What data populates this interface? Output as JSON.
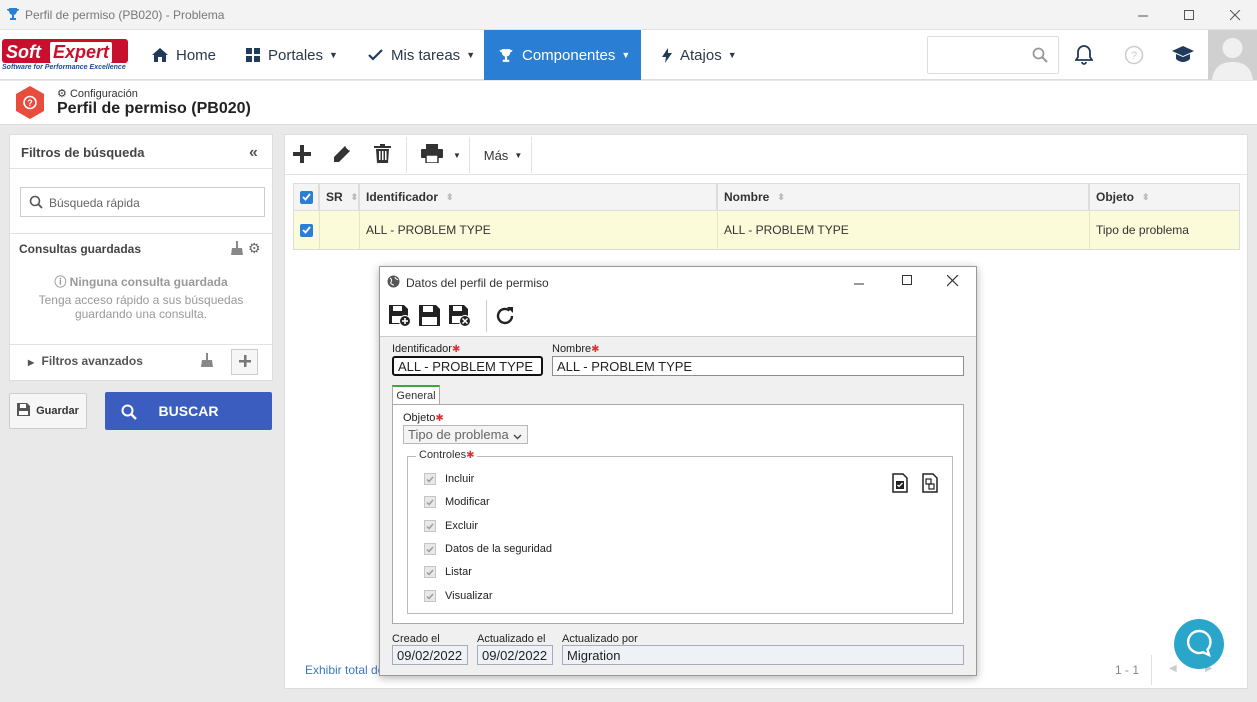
{
  "window": {
    "title": "Perfil de permiso (PB020) - Problema"
  },
  "logo": {
    "brand_soft": "Soft",
    "brand_expert": "Expert",
    "tagline": "Software for Performance Excellence"
  },
  "nav": {
    "home": "Home",
    "portales": "Portales",
    "mis_tareas": "Mis tareas",
    "componentes": "Componentes",
    "atajos": "Atajos"
  },
  "header": {
    "breadcrumb": "Configuración",
    "title": "Perfil de permiso (PB020)"
  },
  "left": {
    "title": "Filtros de búsqueda",
    "quick_search_placeholder": "Búsqueda rápida",
    "saved_queries": "Consultas guardadas",
    "no_saved": "Ninguna consulta guardada",
    "no_saved_hint_1": "Tenga acceso rápido a sus búsquedas",
    "no_saved_hint_2": "guardando una consulta.",
    "advanced": "Filtros avanzados",
    "save_label": "Guardar",
    "search_label": "BUSCAR"
  },
  "main": {
    "more_label": "Más",
    "columns": {
      "sr": "SR",
      "identificador": "Identificador",
      "nombre": "Nombre",
      "objeto": "Objeto"
    },
    "rows": [
      {
        "identificador": "ALL - PROBLEM TYPE",
        "nombre": "ALL - PROBLEM TYPE",
        "objeto": "Tipo de problema"
      }
    ],
    "footer_left": "Exhibir total de",
    "pagination": "1 - 1"
  },
  "modal": {
    "title": "Datos del perfil de permiso",
    "identificador_label": "Identificador",
    "identificador_value": "ALL - PROBLEM TYPE",
    "nombre_label": "Nombre",
    "nombre_value": "ALL - PROBLEM TYPE",
    "tab_general": "General",
    "objeto_label": "Objeto",
    "objeto_value": "Tipo de problema",
    "controles_label": "Controles",
    "controls": [
      "Incluir",
      "Modificar",
      "Excluir",
      "Datos de la seguridad",
      "Listar",
      "Visualizar"
    ],
    "creado_label": "Creado el",
    "creado_value": "09/02/2022",
    "actualizado_label": "Actualizado el",
    "actualizado_value": "09/02/2022",
    "actualizado_por_label": "Actualizado por",
    "actualizado_por_value": "Migration"
  },
  "colors": {
    "accent": "#2a7fd4",
    "buscar": "#3a5dbf",
    "row_highlight": "#fbfbd9",
    "brand_red": "#c8102e",
    "chat": "#2ba6cb"
  }
}
